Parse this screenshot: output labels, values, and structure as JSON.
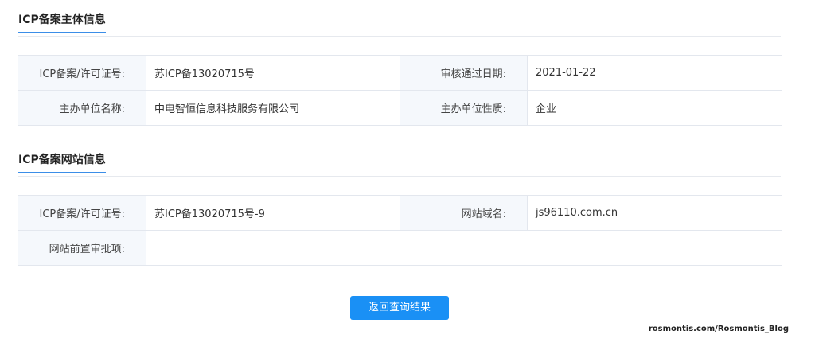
{
  "subject_section": {
    "title": "ICP备案主体信息",
    "rows": [
      {
        "label1": "ICP备案/许可证号:",
        "value1": "苏ICP备13020715号",
        "label2": "审核通过日期:",
        "value2": "2021-01-22"
      },
      {
        "label1": "主办单位名称:",
        "value1": "中电智恒信息科技服务有限公司",
        "label2": "主办单位性质:",
        "value2": "企业"
      }
    ]
  },
  "website_section": {
    "title": "ICP备案网站信息",
    "row1": {
      "label1": "ICP备案/许可证号:",
      "value1": "苏ICP备13020715号-9",
      "label2": "网站域名:",
      "value2": "js96110.com.cn"
    },
    "row2": {
      "label": "网站前置审批项:",
      "value": ""
    }
  },
  "back_button_label": "返回查询结果",
  "watermark": "rosmontis.com/Rosmontis_Blog",
  "colors": {
    "accent": "#1a90f5",
    "label_bg": "#f5f8fc",
    "border": "#e3e7ee"
  }
}
